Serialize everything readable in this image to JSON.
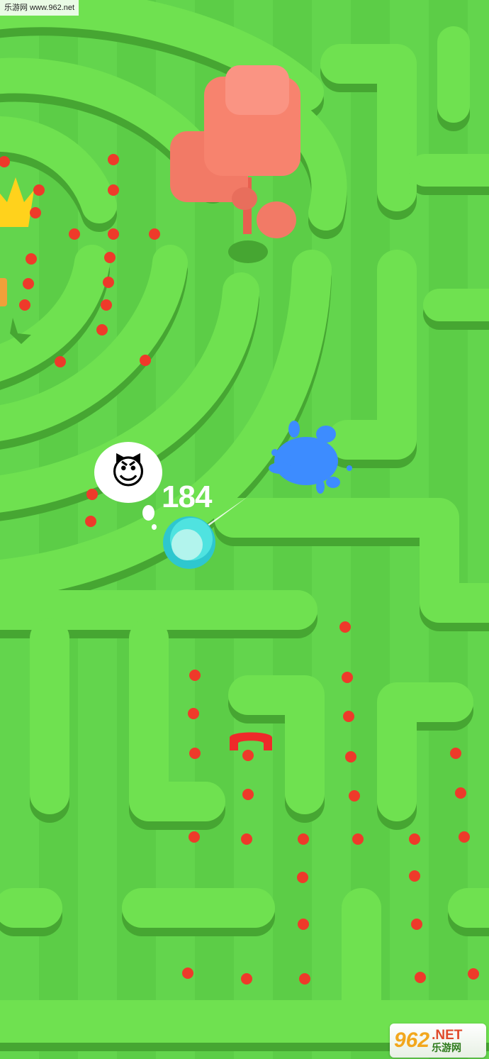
{
  "watermark": {
    "text": "乐游网 www.962.net"
  },
  "hud": {
    "score": "184",
    "opponent_emoji": "😈"
  },
  "logo": {
    "number": "962",
    "suffix": ".NET",
    "brand": "乐游网"
  },
  "colors": {
    "floor": "#5fd24a",
    "wall_top": "#6ee04f",
    "wall_side": "#47a933",
    "dot": "#ee3a2a",
    "player": "#3de0e0",
    "paint_splat": "#3d8cff",
    "tree": "#f57a68",
    "crown": "#ffd21c"
  },
  "icons": [
    "crown-icon",
    "smiling-devil-emoji",
    "tree",
    "red-magnet-icon",
    "paint-splat"
  ]
}
